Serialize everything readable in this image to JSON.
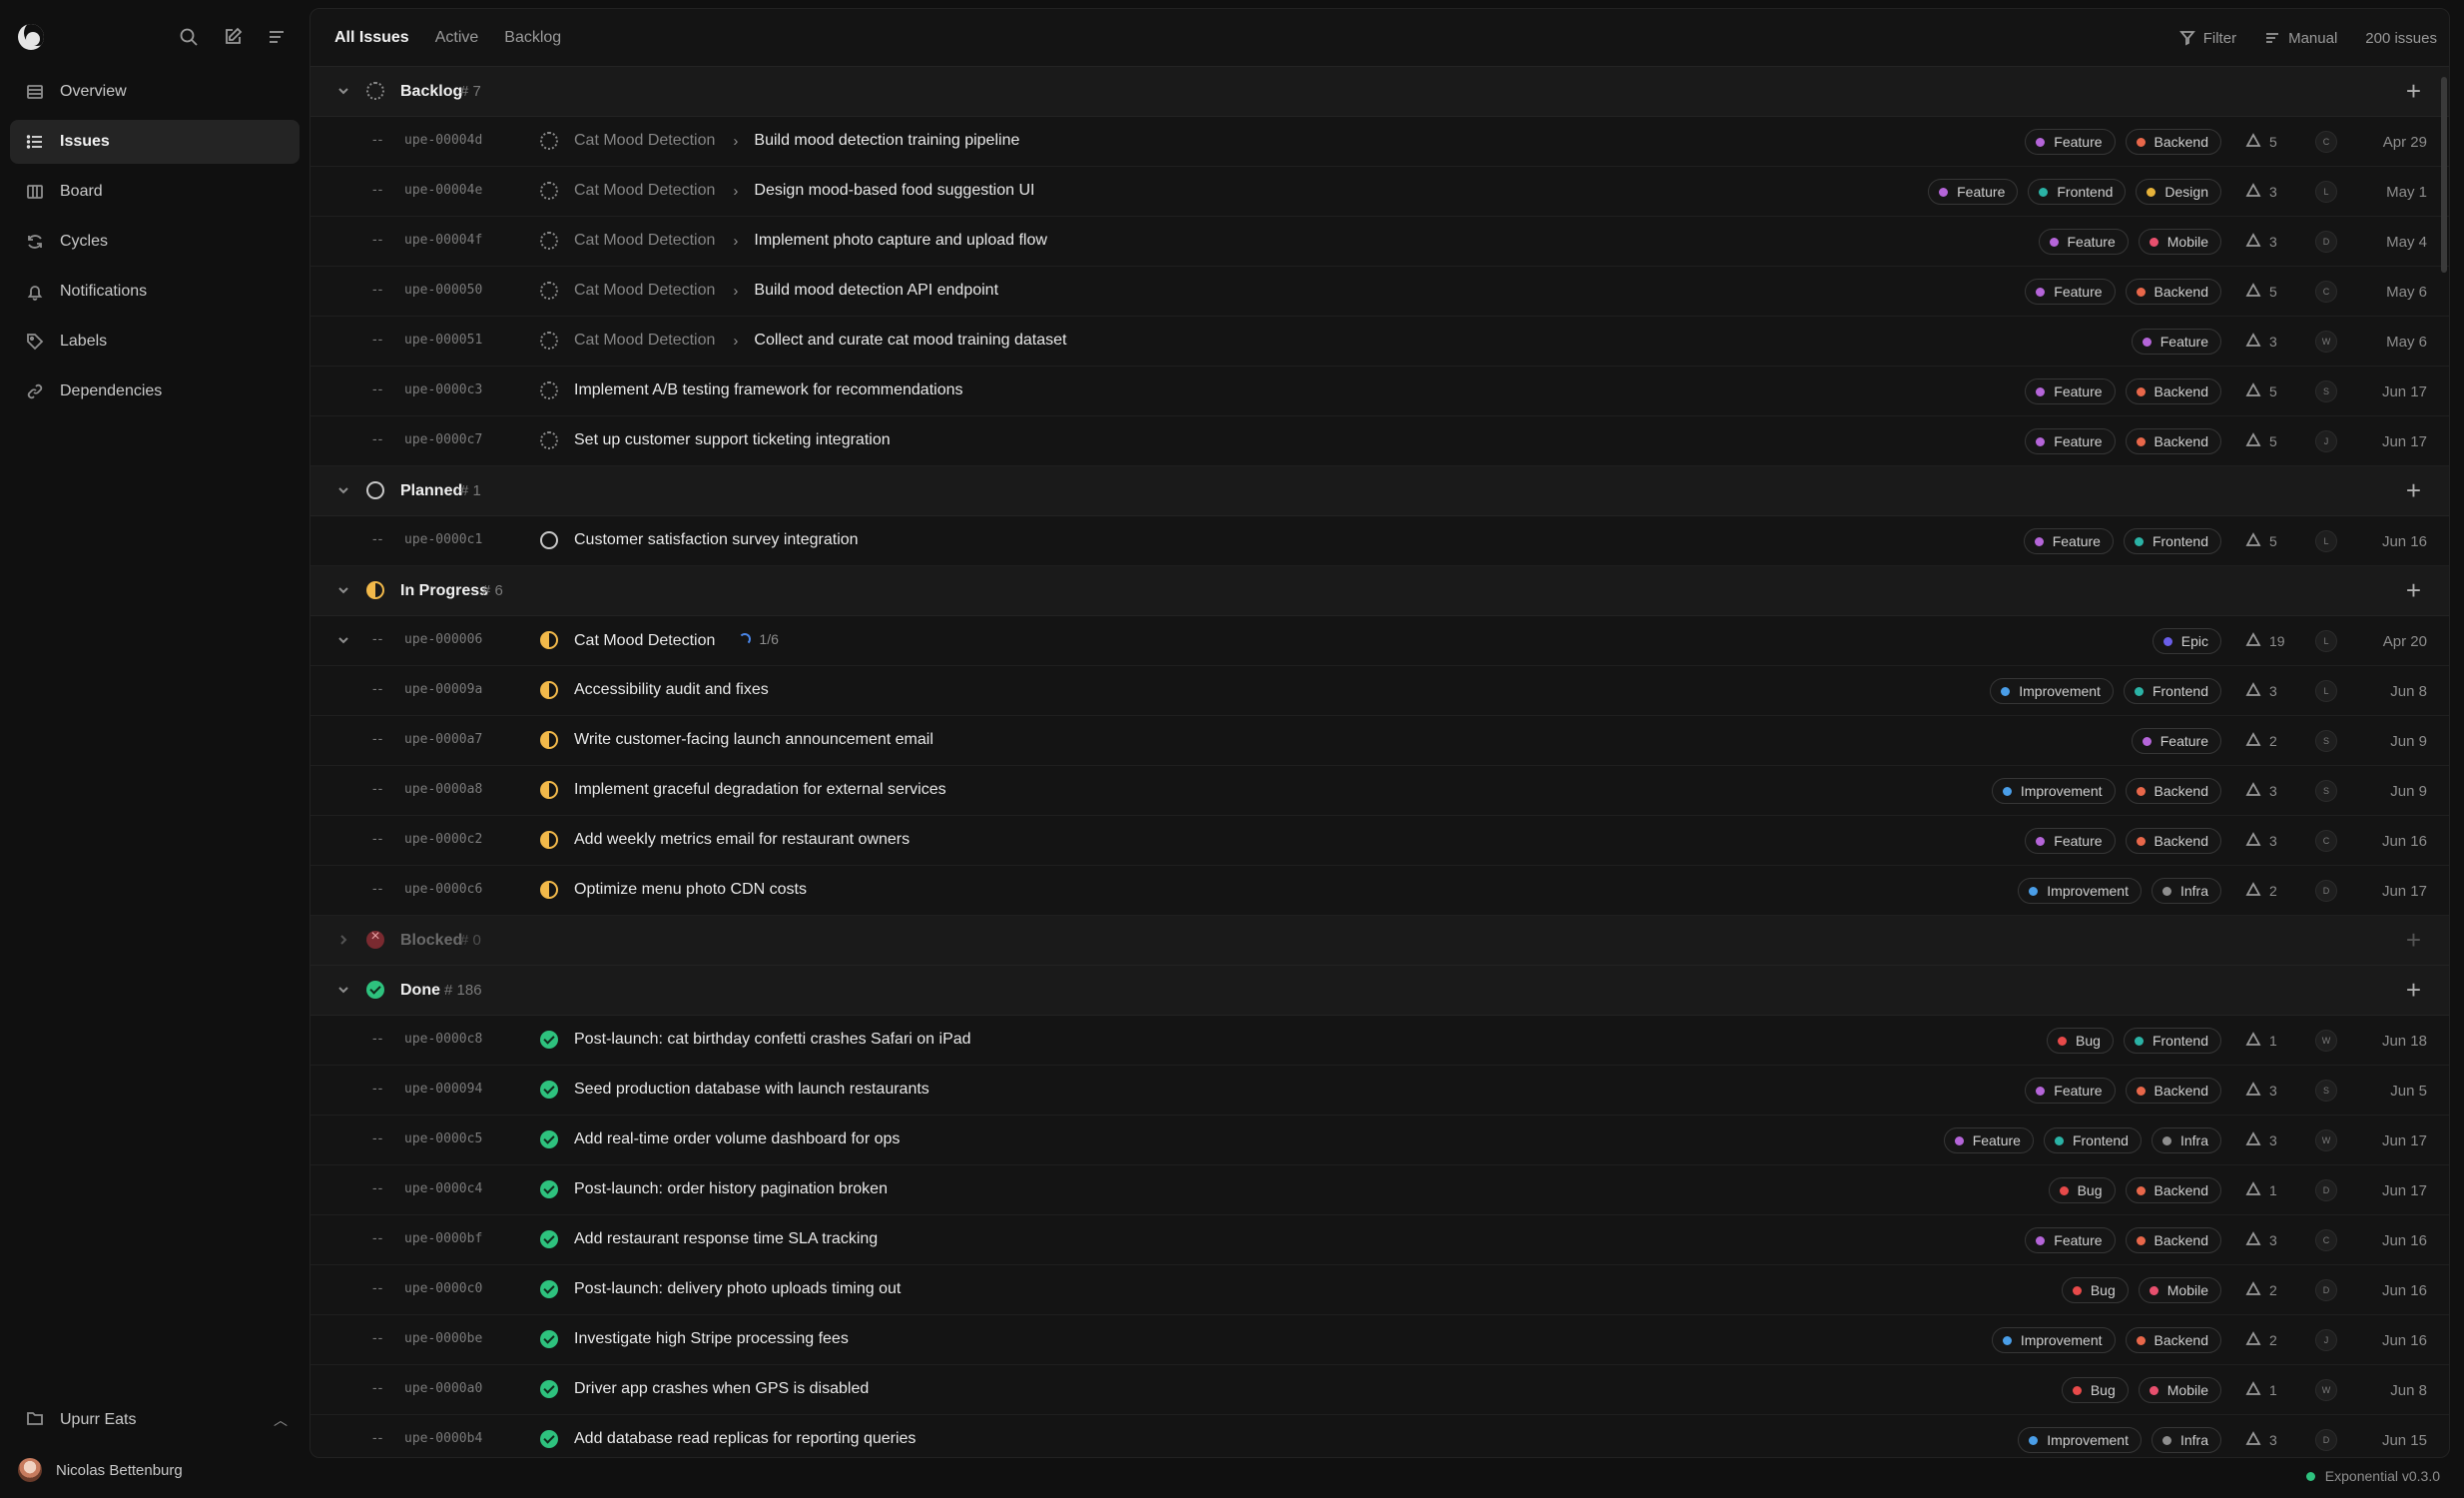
{
  "sidebar": {
    "nav": [
      {
        "label": "Overview",
        "icon": "overview-icon",
        "active": false
      },
      {
        "label": "Issues",
        "icon": "issues-icon",
        "active": true
      },
      {
        "label": "Board",
        "icon": "board-icon",
        "active": false
      },
      {
        "label": "Cycles",
        "icon": "cycles-icon",
        "active": false
      },
      {
        "label": "Notifications",
        "icon": "bell-icon",
        "active": false
      },
      {
        "label": "Labels",
        "icon": "tag-icon",
        "active": false
      },
      {
        "label": "Dependencies",
        "icon": "link-icon",
        "active": false
      }
    ],
    "workspace": "Upurr Eats",
    "user": "Nicolas Bettenburg"
  },
  "tabs": [
    "All Issues",
    "Active",
    "Backlog"
  ],
  "toolbar": {
    "filter": "Filter",
    "sort": "Manual",
    "count": "200 issues"
  },
  "version": "Exponential v0.3.0",
  "label_colors": {
    "Feature": "#b565d9",
    "Backend": "#e8674a",
    "Frontend": "#2bb3a6",
    "Design": "#e6b23a",
    "Mobile": "#e8506e",
    "Epic": "#6a5ee8",
    "Improvement": "#4a9ee8",
    "Infra": "#8e8e8e",
    "Bug": "#e84a4a"
  },
  "groups": [
    {
      "name": "Backlog",
      "count": "# 7",
      "status": "backlog",
      "collapsed": false,
      "dim": false,
      "issues": [
        {
          "id": "upe-00004d",
          "parent": "Cat Mood Detection",
          "title": "Build mood detection training pipeline",
          "labels": [
            "Feature",
            "Backend"
          ],
          "estimate": "5",
          "assignee": "C",
          "date": "Apr 29"
        },
        {
          "id": "upe-00004e",
          "parent": "Cat Mood Detection",
          "title": "Design mood-based food suggestion UI",
          "labels": [
            "Feature",
            "Frontend",
            "Design"
          ],
          "estimate": "3",
          "assignee": "L",
          "date": "May 1"
        },
        {
          "id": "upe-00004f",
          "parent": "Cat Mood Detection",
          "title": "Implement photo capture and upload flow",
          "labels": [
            "Feature",
            "Mobile"
          ],
          "estimate": "3",
          "assignee": "D",
          "date": "May 4"
        },
        {
          "id": "upe-000050",
          "parent": "Cat Mood Detection",
          "title": "Build mood detection API endpoint",
          "labels": [
            "Feature",
            "Backend"
          ],
          "estimate": "5",
          "assignee": "C",
          "date": "May 6"
        },
        {
          "id": "upe-000051",
          "parent": "Cat Mood Detection",
          "title": "Collect and curate cat mood training dataset",
          "labels": [
            "Feature"
          ],
          "estimate": "3",
          "assignee": "W",
          "date": "May 6"
        },
        {
          "id": "upe-0000c3",
          "parent": "",
          "title": "Implement A/B testing framework for recommendations",
          "labels": [
            "Feature",
            "Backend"
          ],
          "estimate": "5",
          "assignee": "S",
          "date": "Jun 17"
        },
        {
          "id": "upe-0000c7",
          "parent": "",
          "title": "Set up customer support ticketing integration",
          "labels": [
            "Feature",
            "Backend"
          ],
          "estimate": "5",
          "assignee": "J",
          "date": "Jun 17"
        }
      ]
    },
    {
      "name": "Planned",
      "count": "# 1",
      "status": "planned",
      "collapsed": false,
      "dim": false,
      "issues": [
        {
          "id": "upe-0000c1",
          "parent": "",
          "title": "Customer satisfaction survey integration",
          "labels": [
            "Feature",
            "Frontend"
          ],
          "estimate": "5",
          "assignee": "L",
          "date": "Jun 16"
        }
      ]
    },
    {
      "name": "In Progress",
      "count": "# 6",
      "status": "progress",
      "collapsed": false,
      "dim": false,
      "issues": [
        {
          "id": "upe-000006",
          "parent": "",
          "title": "Cat Mood Detection",
          "progress": "1/6",
          "expandable": true,
          "labels": [
            "Epic"
          ],
          "estimate": "19",
          "assignee": "L",
          "date": "Apr 20"
        },
        {
          "id": "upe-00009a",
          "parent": "",
          "title": "Accessibility audit and fixes",
          "labels": [
            "Improvement",
            "Frontend"
          ],
          "estimate": "3",
          "assignee": "L",
          "date": "Jun 8"
        },
        {
          "id": "upe-0000a7",
          "parent": "",
          "title": "Write customer-facing launch announcement email",
          "labels": [
            "Feature"
          ],
          "estimate": "2",
          "assignee": "S",
          "date": "Jun 9"
        },
        {
          "id": "upe-0000a8",
          "parent": "",
          "title": "Implement graceful degradation for external services",
          "labels": [
            "Improvement",
            "Backend"
          ],
          "estimate": "3",
          "assignee": "S",
          "date": "Jun 9"
        },
        {
          "id": "upe-0000c2",
          "parent": "",
          "title": "Add weekly metrics email for restaurant owners",
          "labels": [
            "Feature",
            "Backend"
          ],
          "estimate": "3",
          "assignee": "C",
          "date": "Jun 16"
        },
        {
          "id": "upe-0000c6",
          "parent": "",
          "title": "Optimize menu photo CDN costs",
          "labels": [
            "Improvement",
            "Infra"
          ],
          "estimate": "2",
          "assignee": "D",
          "date": "Jun 17"
        }
      ]
    },
    {
      "name": "Blocked",
      "count": "# 0",
      "status": "blocked",
      "collapsed": true,
      "dim": true,
      "issues": []
    },
    {
      "name": "Done",
      "count": "# 186",
      "status": "done",
      "collapsed": false,
      "dim": false,
      "issues": [
        {
          "id": "upe-0000c8",
          "parent": "",
          "title": "Post-launch: cat birthday confetti crashes Safari on iPad",
          "labels": [
            "Bug",
            "Frontend"
          ],
          "estimate": "1",
          "assignee": "W",
          "date": "Jun 18"
        },
        {
          "id": "upe-000094",
          "parent": "",
          "title": "Seed production database with launch restaurants",
          "labels": [
            "Feature",
            "Backend"
          ],
          "estimate": "3",
          "assignee": "S",
          "date": "Jun 5"
        },
        {
          "id": "upe-0000c5",
          "parent": "",
          "title": "Add real-time order volume dashboard for ops",
          "labels": [
            "Feature",
            "Frontend",
            "Infra"
          ],
          "estimate": "3",
          "assignee": "W",
          "date": "Jun 17"
        },
        {
          "id": "upe-0000c4",
          "parent": "",
          "title": "Post-launch: order history pagination broken",
          "labels": [
            "Bug",
            "Backend"
          ],
          "estimate": "1",
          "assignee": "D",
          "date": "Jun 17"
        },
        {
          "id": "upe-0000bf",
          "parent": "",
          "title": "Add restaurant response time SLA tracking",
          "labels": [
            "Feature",
            "Backend"
          ],
          "estimate": "3",
          "assignee": "C",
          "date": "Jun 16"
        },
        {
          "id": "upe-0000c0",
          "parent": "",
          "title": "Post-launch: delivery photo uploads timing out",
          "labels": [
            "Bug",
            "Mobile"
          ],
          "estimate": "2",
          "assignee": "D",
          "date": "Jun 16"
        },
        {
          "id": "upe-0000be",
          "parent": "",
          "title": "Investigate high Stripe processing fees",
          "labels": [
            "Improvement",
            "Backend"
          ],
          "estimate": "2",
          "assignee": "J",
          "date": "Jun 16"
        },
        {
          "id": "upe-0000a0",
          "parent": "",
          "title": "Driver app crashes when GPS is disabled",
          "labels": [
            "Bug",
            "Mobile"
          ],
          "estimate": "1",
          "assignee": "W",
          "date": "Jun 8"
        },
        {
          "id": "upe-0000b4",
          "parent": "",
          "title": "Add database read replicas for reporting queries",
          "labels": [
            "Improvement",
            "Infra"
          ],
          "estimate": "3",
          "assignee": "D",
          "date": "Jun 15"
        }
      ]
    }
  ]
}
